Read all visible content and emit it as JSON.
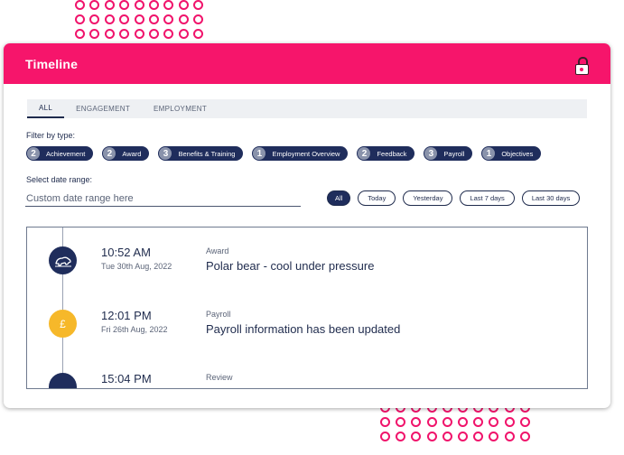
{
  "window": {
    "title": "Timeline"
  },
  "tabs": [
    {
      "label": "ALL",
      "active": true
    },
    {
      "label": "ENGAGEMENT",
      "active": false
    },
    {
      "label": "EMPLOYMENT",
      "active": false
    }
  ],
  "filters": {
    "label": "Filter by type:",
    "chips": [
      {
        "count": "2",
        "label": "Achievement"
      },
      {
        "count": "2",
        "label": "Award"
      },
      {
        "count": "3",
        "label": "Benefits & Training"
      },
      {
        "count": "1",
        "label": "Employment Overview"
      },
      {
        "count": "2",
        "label": "Feedback"
      },
      {
        "count": "3",
        "label": "Payroll"
      },
      {
        "count": "1",
        "label": "Objectives"
      }
    ]
  },
  "date_range": {
    "label": "Select date range:",
    "placeholder": "Custom date range here",
    "options": [
      {
        "label": "All",
        "active": true
      },
      {
        "label": "Today",
        "active": false
      },
      {
        "label": "Yesterday",
        "active": false
      },
      {
        "label": "Last 7 days",
        "active": false
      },
      {
        "label": "Last 30 days",
        "active": false
      }
    ]
  },
  "entries": [
    {
      "time": "10:52 AM",
      "date": "Tue 30th Aug, 2022",
      "type": "Award",
      "description": "Polar bear - cool under pressure",
      "icon": "polar-bear-icon",
      "color": "#1f2d5c"
    },
    {
      "time": "12:01 PM",
      "date": "Fri 26th Aug, 2022",
      "type": "Payroll",
      "description": "Payroll information has been updated",
      "icon": "pound-icon",
      "color": "#f6b82a",
      "glyph": "£"
    },
    {
      "time": "15:04 PM",
      "date": "",
      "type": "Review",
      "description": "",
      "icon": "review-icon",
      "color": "#1f2d5c"
    }
  ],
  "colors": {
    "brand": "#f6156b",
    "navy": "#1f2d5c",
    "accent_yellow": "#f6b82a"
  }
}
